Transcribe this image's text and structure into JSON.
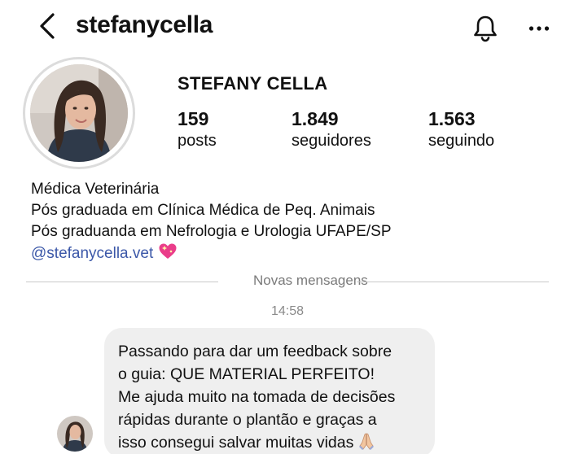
{
  "header": {
    "username": "stefanycella",
    "back_icon": "chevron-left-icon",
    "notification_icon": "bell-icon",
    "more_icon": "more-horizontal-icon"
  },
  "profile": {
    "display_name": "STEFANY CELLA",
    "stats": [
      {
        "value": "159",
        "label": "posts"
      },
      {
        "value": "1.849",
        "label": "seguidores"
      },
      {
        "value": "1.563",
        "label": "seguindo"
      }
    ],
    "bio": {
      "lines": [
        "Médica Veterinária",
        "Pós graduada em Clínica Médica de Peq. Animais",
        "Pós graduanda em Nefrologia e Urologia UFAPE/SP"
      ],
      "link": "@stefanycella.vet",
      "link_emoji": "sparkling-heart-icon"
    }
  },
  "chat": {
    "divider_label": "Novas mensagens",
    "timestamp": "14:58",
    "message": {
      "lines": [
        "Passando para dar um feedback sobre",
        "o guia: QUE MATERIAL PERFEITO!",
        "Me ajuda muito na tomada de decisões",
        "rápidas durante o plantão e graças a",
        "isso consegui salvar muitas vidas"
      ],
      "emoji": "folded-hands-icon"
    }
  },
  "colors": {
    "text": "#111111",
    "link": "#3b57a8",
    "muted": "#7a7a7a",
    "bubble": "#efefef",
    "avatar_ring": "#dcdcdc"
  }
}
